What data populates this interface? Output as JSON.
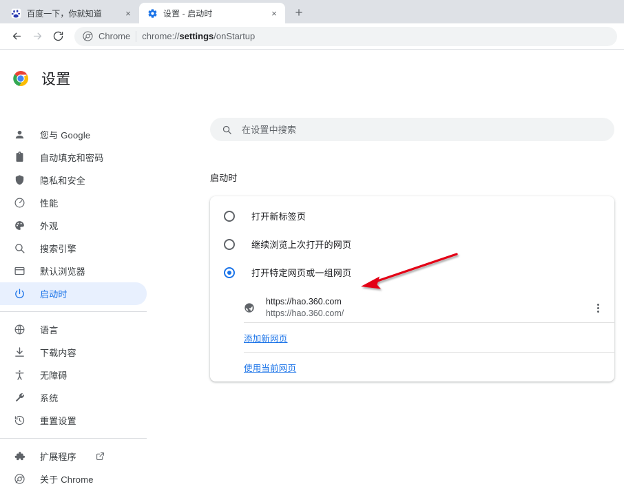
{
  "browser": {
    "tabs": [
      {
        "title": "百度一下，你就知道",
        "favicon": "baidu-icon",
        "active": false,
        "close_label": "×"
      },
      {
        "title": "设置 - 启动时",
        "favicon": "settings-gear-icon",
        "active": true,
        "close_label": "×"
      }
    ],
    "new_tab_label": "+",
    "toolbar": {
      "back_label": "←",
      "forward_label": "→",
      "reload_label": "⟳",
      "omnibox": {
        "chip_label": "Chrome",
        "url_prefix": "chrome://",
        "url_bold": "settings",
        "url_suffix": "/onStartup"
      }
    }
  },
  "settings": {
    "header": {
      "title": "设置",
      "logo": "chrome-logo-icon"
    },
    "search": {
      "placeholder": "在设置中搜索",
      "value": "",
      "icon": "search-icon"
    },
    "sidebar": {
      "items": [
        {
          "label": "您与 Google",
          "icon": "person-icon",
          "selected": false
        },
        {
          "label": "自动填充和密码",
          "icon": "clipboard-icon",
          "selected": false
        },
        {
          "label": "隐私和安全",
          "icon": "shield-icon",
          "selected": false
        },
        {
          "label": "性能",
          "icon": "speedometer-icon",
          "selected": false
        },
        {
          "label": "外观",
          "icon": "palette-icon",
          "selected": false
        },
        {
          "label": "搜索引擎",
          "icon": "magnifier-icon",
          "selected": false
        },
        {
          "label": "默认浏览器",
          "icon": "browser-window-icon",
          "selected": false
        },
        {
          "label": "启动时",
          "icon": "power-icon",
          "selected": true
        }
      ],
      "group2": [
        {
          "label": "语言",
          "icon": "globe-icon"
        },
        {
          "label": "下载内容",
          "icon": "download-icon"
        },
        {
          "label": "无障碍",
          "icon": "accessibility-icon"
        },
        {
          "label": "系统",
          "icon": "wrench-icon"
        },
        {
          "label": "重置设置",
          "icon": "history-restore-icon"
        }
      ],
      "group3": [
        {
          "label": "扩展程序",
          "icon": "puzzle-icon",
          "external": true,
          "external_icon": "open-in-new-icon"
        },
        {
          "label": "关于 Chrome",
          "icon": "chrome-outline-icon",
          "external": false
        }
      ]
    },
    "main": {
      "section_title": "启动时",
      "radio_options": [
        {
          "label": "打开新标签页",
          "checked": false
        },
        {
          "label": "继续浏览上次打开的网页",
          "checked": false
        },
        {
          "label": "打开特定网页或一组网页",
          "checked": true
        }
      ],
      "startup_pages": [
        {
          "title": "https://hao.360.com",
          "url": "https://hao.360.com/",
          "favicon": "globe-favicon-icon",
          "menu_icon": "kebab-menu-icon"
        }
      ],
      "add_page_link": "添加新网页",
      "use_current_link": "使用当前网页"
    }
  },
  "annotation": {
    "arrow_color": "#e30613",
    "description": "red-arrow-pointing-to-startup-page-entry"
  }
}
